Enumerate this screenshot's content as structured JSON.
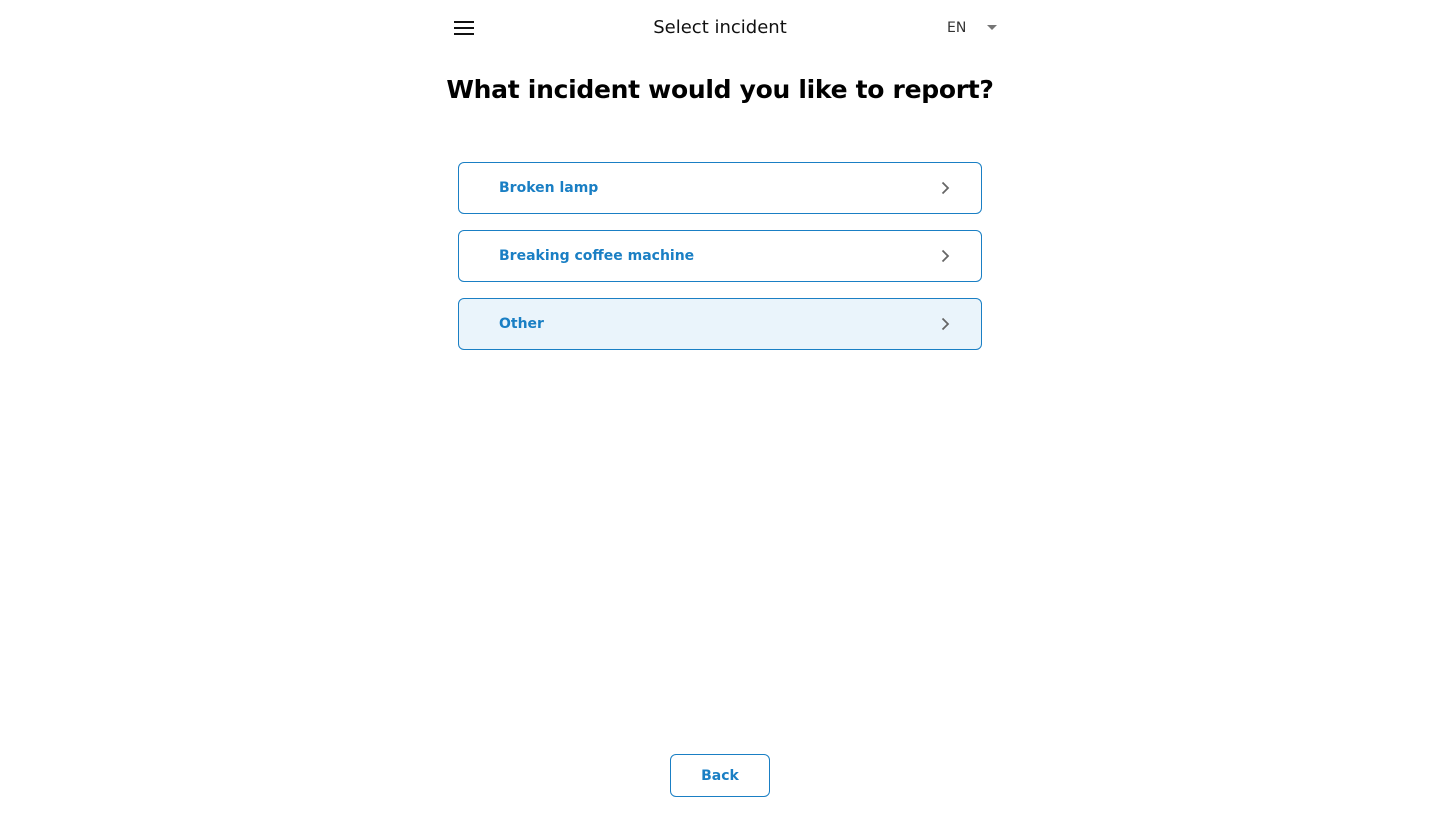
{
  "header": {
    "menu_icon": "hamburger-menu-icon",
    "title": "Select incident",
    "language": {
      "selected": "EN",
      "caret_icon": "caret-down-icon"
    }
  },
  "main": {
    "question": "What incident would you like to report?",
    "options": [
      {
        "label": "Broken lamp",
        "icon": "chevron-right-icon"
      },
      {
        "label": "Breaking coffee machine",
        "icon": "chevron-right-icon"
      },
      {
        "label": "Other",
        "icon": "chevron-right-icon",
        "state": "hovered"
      }
    ]
  },
  "footer": {
    "back_label": "Back"
  },
  "colors": {
    "accent": "#1a7fc4",
    "hover_background": "#eaf4fb",
    "text": "#111111"
  }
}
